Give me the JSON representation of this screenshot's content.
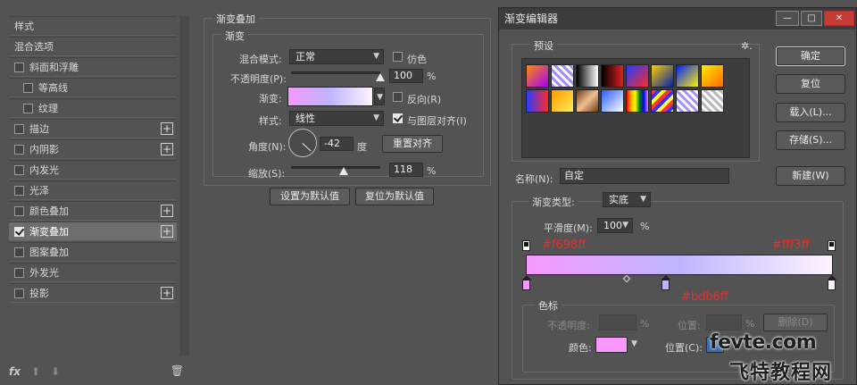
{
  "styles_panel": {
    "items": [
      {
        "label": "样式",
        "checkbox": false,
        "checked": false,
        "plus": false,
        "selected": false,
        "sub": false
      },
      {
        "label": "混合选项",
        "checkbox": false,
        "checked": false,
        "plus": false,
        "selected": false,
        "sub": false
      },
      {
        "label": "斜面和浮雕",
        "checkbox": true,
        "checked": false,
        "plus": false,
        "selected": false,
        "sub": false
      },
      {
        "label": "等高线",
        "checkbox": true,
        "checked": false,
        "plus": false,
        "selected": false,
        "sub": true
      },
      {
        "label": "纹理",
        "checkbox": true,
        "checked": false,
        "plus": false,
        "selected": false,
        "sub": true
      },
      {
        "label": "描边",
        "checkbox": true,
        "checked": false,
        "plus": true,
        "selected": false,
        "sub": false
      },
      {
        "label": "内阴影",
        "checkbox": true,
        "checked": false,
        "plus": true,
        "selected": false,
        "sub": false
      },
      {
        "label": "内发光",
        "checkbox": true,
        "checked": false,
        "plus": false,
        "selected": false,
        "sub": false
      },
      {
        "label": "光泽",
        "checkbox": true,
        "checked": false,
        "plus": false,
        "selected": false,
        "sub": false
      },
      {
        "label": "颜色叠加",
        "checkbox": true,
        "checked": false,
        "plus": true,
        "selected": false,
        "sub": false
      },
      {
        "label": "渐变叠加",
        "checkbox": true,
        "checked": true,
        "plus": true,
        "selected": true,
        "sub": false
      },
      {
        "label": "图案叠加",
        "checkbox": true,
        "checked": false,
        "plus": false,
        "selected": false,
        "sub": false
      },
      {
        "label": "外发光",
        "checkbox": true,
        "checked": false,
        "plus": false,
        "selected": false,
        "sub": false
      },
      {
        "label": "投影",
        "checkbox": true,
        "checked": false,
        "plus": true,
        "selected": false,
        "sub": false
      }
    ],
    "footer_fx": "fx",
    "footer_up": "⬆",
    "footer_down": "⬇",
    "footer_trash": "🗑"
  },
  "gradient_overlay": {
    "title": "渐变叠加",
    "subtitle": "渐变",
    "blend_mode_label": "混合模式:",
    "blend_mode_value": "正常",
    "dither_label": "仿色",
    "opacity_label": "不透明度(P):",
    "opacity_value": "100",
    "opacity_unit": "%",
    "gradient_label": "渐变:",
    "reverse_label": "反向(R)",
    "style_label": "样式:",
    "style_value": "线性",
    "align_label": "与图层对齐(I)",
    "angle_label": "角度(N):",
    "angle_value": "-42",
    "angle_unit": "度",
    "reset_align_button": "重置对齐",
    "scale_label": "缩放(S):",
    "scale_value": "118",
    "scale_unit": "%",
    "set_default_button": "设置为默认值",
    "reset_default_button": "复位为默认值",
    "opacity_fraction": 1.0,
    "scale_fraction": 0.59
  },
  "gradient_editor": {
    "title": "渐变编辑器",
    "presets_label": "预设",
    "gear": "✲.",
    "buttons": {
      "ok": "确定",
      "reset": "复位",
      "load": "载入(L)...",
      "save": "存储(S)...",
      "new": "新建(W)"
    },
    "name_label": "名称(N):",
    "name_value": "自定",
    "type_label": "渐变类型:",
    "type_value": "实底",
    "smoothness_label": "平滑度(M):",
    "smoothness_value": "100",
    "smoothness_unit": "%",
    "stops_label": "色标",
    "opacity_label": "不透明度:",
    "opacity_unit": "%",
    "location_label_1": "位置:",
    "location_unit_1": "%",
    "delete_button": "删除(D)",
    "color_label": "颜色:",
    "location_label_2": "位置(C):",
    "hex_left": "#f698ff",
    "hex_right": "#fff3ff",
    "hex_mid": "#bdb6ff",
    "colors": {
      "left": "#f698ff",
      "mid": "#bdb6ff",
      "right": "#fff3ff"
    }
  },
  "window_buttons": {
    "minimize": "—",
    "maximize": "□",
    "close": "✕"
  },
  "watermark": {
    "line1": "fevte.com",
    "line2": "飞特教程网"
  }
}
